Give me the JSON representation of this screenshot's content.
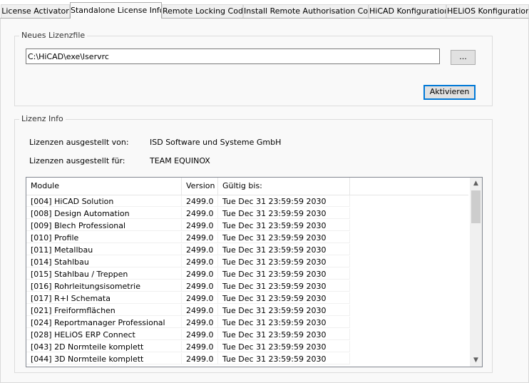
{
  "tabs": [
    {
      "label": "License Activator"
    },
    {
      "label": "Standalone License Info"
    },
    {
      "label": "Remote Locking Code"
    },
    {
      "label": "Install Remote Authorisation Code"
    },
    {
      "label": "HiCAD Konfiguration"
    },
    {
      "label": "HELiOS Konfiguration"
    }
  ],
  "active_tab": "Standalone License Info",
  "new_license": {
    "legend": "Neues Lizenzfile",
    "path_value": "C:\\HiCAD\\exe\\lservrc",
    "browse_label": "...",
    "activate_label": "Aktivieren"
  },
  "license_info": {
    "legend": "Lizenz Info",
    "issued_by_label": "Lizenzen ausgestellt von:",
    "issued_by_value": "ISD Software und Systeme GmbH",
    "issued_for_label": "Lizenzen ausgestellt für:",
    "issued_for_value": "TEAM EQUINOX"
  },
  "table": {
    "columns": [
      "Module",
      "Version",
      "Gültig bis:"
    ],
    "rows": [
      [
        "[004] HiCAD Solution",
        "2499.0",
        "Tue Dec 31 23:59:59 2030"
      ],
      [
        "[008] Design Automation",
        "2499.0",
        "Tue Dec 31 23:59:59 2030"
      ],
      [
        "[009] Blech Professional",
        "2499.0",
        "Tue Dec 31 23:59:59 2030"
      ],
      [
        "[010] Profile",
        "2499.0",
        "Tue Dec 31 23:59:59 2030"
      ],
      [
        "[011] Metallbau",
        "2499.0",
        "Tue Dec 31 23:59:59 2030"
      ],
      [
        "[014] Stahlbau",
        "2499.0",
        "Tue Dec 31 23:59:59 2030"
      ],
      [
        "[015] Stahlbau / Treppen",
        "2499.0",
        "Tue Dec 31 23:59:59 2030"
      ],
      [
        "[016] Rohrleitungsisometrie",
        "2499.0",
        "Tue Dec 31 23:59:59 2030"
      ],
      [
        "[017] R+I Schemata",
        "2499.0",
        "Tue Dec 31 23:59:59 2030"
      ],
      [
        "[021] Freiformflächen",
        "2499.0",
        "Tue Dec 31 23:59:59 2030"
      ],
      [
        "[024] Reportmanager Professional",
        "2499.0",
        "Tue Dec 31 23:59:59 2030"
      ],
      [
        "[028] HELiOS ERP Connect",
        "2499.0",
        "Tue Dec 31 23:59:59 2030"
      ],
      [
        "[043] 2D Normteile komplett",
        "2499.0",
        "Tue Dec 31 23:59:59 2030"
      ],
      [
        "[044] 3D Normteile komplett",
        "2499.0",
        "Tue Dec 31 23:59:59 2030"
      ]
    ]
  },
  "icons": {
    "scroll_up": "chevron-up-icon",
    "scroll_down": "chevron-down-icon"
  }
}
